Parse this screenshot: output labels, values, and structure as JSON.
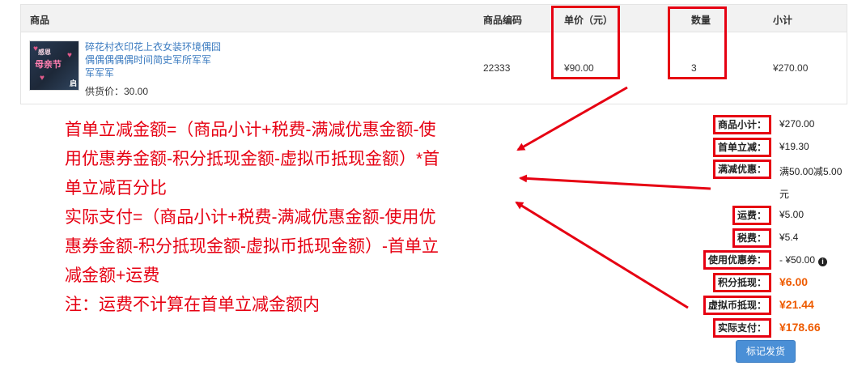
{
  "table": {
    "headers": {
      "product": "商品",
      "code": "商品编码",
      "unit_price": "单价（元）",
      "quantity": "数量",
      "subtotal": "小计"
    },
    "row": {
      "name_lines": [
        "碎花村衣印花上衣女装环境偶囧",
        "偶偶偶偶偶时间简史军所军军",
        "军军军"
      ],
      "supply_price": "供货价：30.00",
      "code": "22333",
      "unit_price": "¥90.00",
      "quantity": "3",
      "subtotal": "¥270.00",
      "thumb_text": {
        "top": "感恩",
        "main": "母亲节",
        "corner": "启"
      }
    }
  },
  "note": {
    "lines": [
      "首单立减金额=（商品小计+税费-满减优惠金额-使",
      "用优惠券金额-积分抵现金额-虚拟币抵现金额）*首",
      "单立减百分比",
      "实际支付=（商品小计+税费-满减优惠金额-使用优",
      "惠券金额-积分抵现金额-虚拟币抵现金额）-首单立",
      "减金额+运费",
      "注：运费不计算在首单立减金额内"
    ]
  },
  "summary": {
    "subtotal_label": "商品小计：",
    "subtotal_value": "¥270.00",
    "first_order_label": "首单立减：",
    "first_order_value": "¥19.30",
    "full_reduction_label": "满减优惠：",
    "full_reduction_value_line1": "满50.00减5.00",
    "full_reduction_value_line2": "元",
    "shipping_label": "运费：",
    "shipping_value": "¥5.00",
    "tax_label": "税费：",
    "tax_value": "¥5.4",
    "coupon_label": "使用优惠券：",
    "coupon_value": "- ¥50.00",
    "points_label": "积分抵现：",
    "points_value": "¥6.00",
    "virtual_label": "虚拟币抵现：",
    "virtual_value": "¥21.44",
    "paid_label": "实际支付：",
    "paid_value": "¥178.66"
  },
  "actions": {
    "ship_button": "标记发货"
  },
  "colors": {
    "annotation_red": "#e60012",
    "price_orange": "#ee5b00",
    "button_blue": "#4a8fd6",
    "link_blue": "#3b7bc0"
  },
  "icons": {
    "coupon_info": "info-icon"
  }
}
